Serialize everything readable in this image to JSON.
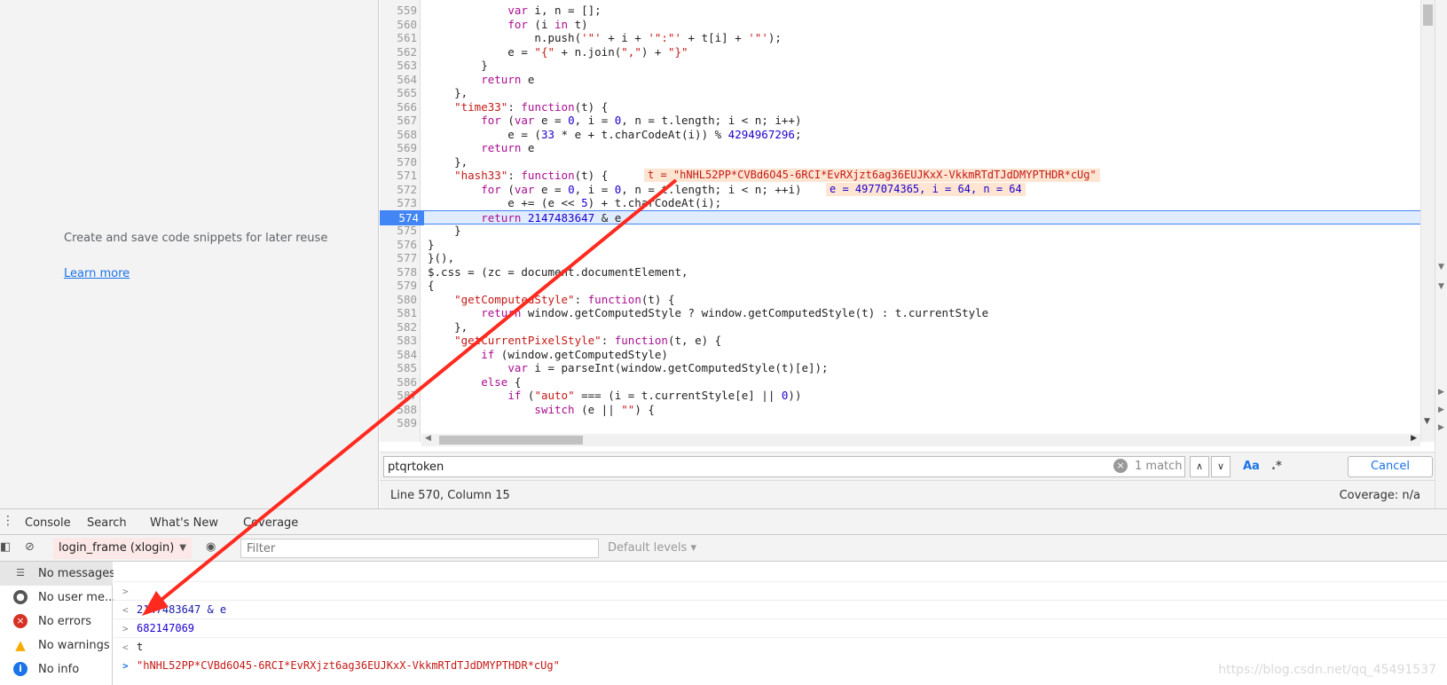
{
  "snippets": {
    "message": "Create and save code snippets for later reuse",
    "learn_more": "Learn more"
  },
  "editor": {
    "lines": [
      {
        "n": "559",
        "code": "            var i, n = [];"
      },
      {
        "n": "560",
        "code": "            for (i in t)"
      },
      {
        "n": "561",
        "code": "                n.push('\"' + i + '\":\"' + t[i] + '\"');"
      },
      {
        "n": "562",
        "code": "            e = \"{\" + n.join(\",\") + \"}\""
      },
      {
        "n": "563",
        "code": "        }"
      },
      {
        "n": "564",
        "code": "        return e"
      },
      {
        "n": "565",
        "code": "    },"
      },
      {
        "n": "566",
        "code": "    \"time33\": function(t) {"
      },
      {
        "n": "567",
        "code": "        for (var e = 0, i = 0, n = t.length; i < n; i++)"
      },
      {
        "n": "568",
        "code": "            e = (33 * e + t.charCodeAt(i)) % 4294967296;"
      },
      {
        "n": "569",
        "code": "        return e"
      },
      {
        "n": "570",
        "code": "    },"
      },
      {
        "n": "571",
        "code": "    \"hash33\": function(t) {"
      },
      {
        "n": "572",
        "code": "        for (var e = 0, i = 0, n = t.length; i < n; ++i)"
      },
      {
        "n": "573",
        "code": "            e += (e << 5) + t.charCodeAt(i);"
      },
      {
        "n": "574",
        "code": "        return 2147483647 & e"
      },
      {
        "n": "575",
        "code": "    }"
      },
      {
        "n": "576",
        "code": "}"
      },
      {
        "n": "577",
        "code": "}(),"
      },
      {
        "n": "578",
        "code": "$.css = (zc = document.documentElement,"
      },
      {
        "n": "579",
        "code": "{"
      },
      {
        "n": "580",
        "code": "    \"getComputedStyle\": function(t) {"
      },
      {
        "n": "581",
        "code": "        return window.getComputedStyle ? window.getComputedStyle(t) : t.currentStyle"
      },
      {
        "n": "582",
        "code": "    },"
      },
      {
        "n": "583",
        "code": "    \"getCurrentPixelStyle\": function(t, e) {"
      },
      {
        "n": "584",
        "code": "        if (window.getComputedStyle)"
      },
      {
        "n": "585",
        "code": "            var i = parseInt(window.getComputedStyle(t)[e]);"
      },
      {
        "n": "586",
        "code": "        else {"
      },
      {
        "n": "587",
        "code": "            if (\"auto\" === (i = t.currentStyle[e] || 0))"
      },
      {
        "n": "588",
        "code": "                switch (e || \"\") {"
      },
      {
        "n": "589",
        "code": ""
      }
    ],
    "inline_t": "t = \"hNHL52PP*CVBd6O45-6RCI*EvRXjzt6ag36EUJKxX-VkkmRTdTJdDMYPTHDR*cUg\"",
    "inline_vars": "e = 4977074365, i = 64, n = 64"
  },
  "search": {
    "query": "ptqrtoken",
    "match_count": "1 match",
    "case_label": "Aa",
    "regex_label": ".*",
    "cancel": "Cancel"
  },
  "status": {
    "position": "Line 570, Column 15",
    "coverage": "Coverage: n/a"
  },
  "drawer": {
    "tabs": [
      "Console",
      "Search",
      "What's New",
      "Coverage"
    ],
    "context": "login_frame (xlogin)",
    "filter_placeholder": "Filter",
    "levels": "Default levels"
  },
  "sidebar": [
    {
      "label": "No messages",
      "icon": "list-icon"
    },
    {
      "label": "No user me...",
      "icon": "user-icon"
    },
    {
      "label": "No errors",
      "icon": "error-icon"
    },
    {
      "label": "No warnings",
      "icon": "warning-icon"
    },
    {
      "label": "No info",
      "icon": "info-icon"
    }
  ],
  "console": [
    {
      "prompt": ">",
      "text": "2147483647 & e",
      "kind": "input"
    },
    {
      "prompt": "<",
      "text": "682147069",
      "kind": "num"
    },
    {
      "prompt": ">",
      "text": "t",
      "kind": "plain"
    },
    {
      "prompt": "<",
      "text": "\"hNHL52PP*CVBd6O45-6RCI*EvRXjzt6ag36EUJKxX-VkkmRTdTJdDMYPTHDR*cUg\"",
      "kind": "str"
    }
  ],
  "watermark": "https://blog.csdn.net/qq_45491537",
  "colors": {
    "accent": "#1a73e8",
    "exec_line": "#4285f4",
    "annotation_arrow": "#ff2a1f"
  }
}
